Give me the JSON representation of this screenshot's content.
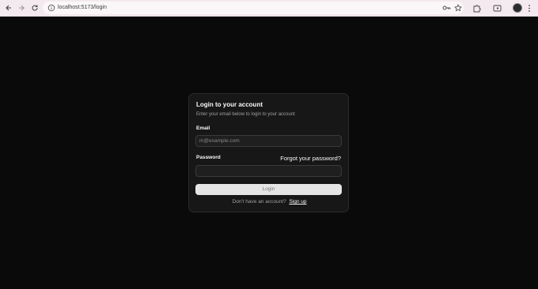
{
  "browser": {
    "url": "localhost:5173/login",
    "icons": [
      "back-arrow-icon",
      "forward-arrow-icon",
      "reload-icon",
      "site-info-icon",
      "password-key-icon",
      "star-icon",
      "extensions-icon",
      "tab-search-icon",
      "profile-avatar",
      "menu-dots-icon"
    ]
  },
  "login": {
    "title": "Login to your account",
    "description": "Enter your email below to login to your account",
    "email_label": "Email",
    "email_placeholder": "m@example.com",
    "email_value": "",
    "password_label": "Password",
    "forgot_link": "Forgot your password?",
    "password_value": "",
    "login_button": "Login",
    "signup_prompt": "Don't have an account?",
    "signup_link": "Sign up"
  },
  "colors": {
    "page_background": "#0a0a0a",
    "card_background": "#171717",
    "card_border": "#2a2a2a",
    "primary_text": "#fafafa",
    "muted_text": "#a1a1a1",
    "button_background": "#e5e5e5",
    "browser_bar": "#f3e9ef"
  }
}
